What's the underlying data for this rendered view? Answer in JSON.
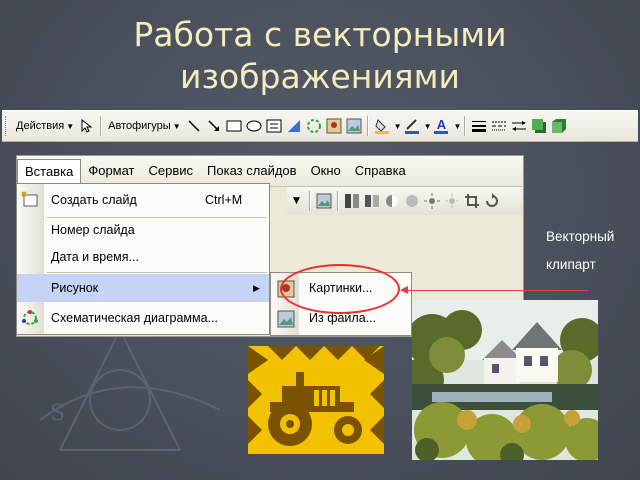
{
  "slide": {
    "title_line1": "Работа с векторными",
    "title_line2": "изображениями",
    "note_line1": "Векторный",
    "note_line2": "клипарт"
  },
  "draw_toolbar": {
    "actions_label": "Действия",
    "autoshapes_label": "Автофигуры",
    "font_color_letter": "A"
  },
  "menubar": {
    "items": [
      "Вставка",
      "Формат",
      "Сервис",
      "Показ слайдов",
      "Окно",
      "Справка"
    ],
    "active": "Вставка"
  },
  "insert_menu": {
    "items": [
      {
        "label": "Создать слайд",
        "shortcut": "Ctrl+M"
      },
      {
        "label": "Номер слайда"
      },
      {
        "label": "Дата и время..."
      },
      {
        "label": "Рисунок",
        "submenu": true
      },
      {
        "label": "Схематическая диаграмма..."
      }
    ]
  },
  "picture_submenu": {
    "items": [
      "Картинки...",
      "Из файла..."
    ]
  },
  "colors": {
    "title": "#f3ecbe",
    "highlight_circle": "#e8302c",
    "menu_highlight": "#c6d3f7",
    "tractor_bg": "#f2c200",
    "tractor_fg": "#7a5200"
  },
  "icons": [
    "pointer-icon",
    "line-icon",
    "arrow-icon",
    "rectangle-icon",
    "oval-icon",
    "textbox-icon",
    "wordart-icon",
    "diagram-icon",
    "clipart-icon",
    "picture-icon",
    "fill-color-icon",
    "line-color-icon",
    "font-color-icon",
    "line-style-icon",
    "dash-style-icon",
    "arrow-style-icon",
    "shadow-icon",
    "3d-icon"
  ]
}
